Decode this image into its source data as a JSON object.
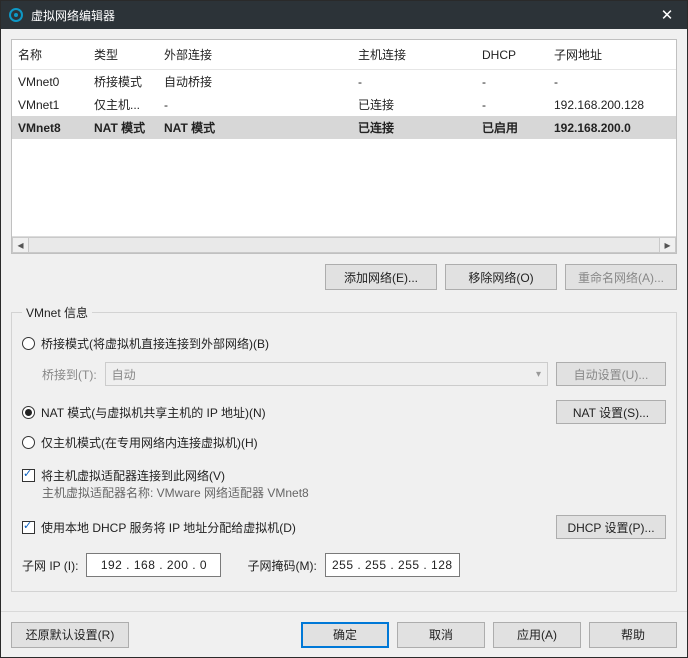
{
  "title": "虚拟网络编辑器",
  "table": {
    "headers": {
      "name": "名称",
      "type": "类型",
      "external": "外部连接",
      "host": "主机连接",
      "dhcp": "DHCP",
      "subnet": "子网地址"
    },
    "rows": [
      {
        "name": "VMnet0",
        "type": "桥接模式",
        "external": "自动桥接",
        "host": "-",
        "dhcp": "-",
        "subnet": "-",
        "selected": false
      },
      {
        "name": "VMnet1",
        "type": "仅主机...",
        "external": "-",
        "host": "已连接",
        "dhcp": "-",
        "subnet": "192.168.200.128",
        "selected": false
      },
      {
        "name": "VMnet8",
        "type": "NAT 模式",
        "external": "NAT 模式",
        "host": "已连接",
        "dhcp": "已启用",
        "subnet": "192.168.200.0",
        "selected": true
      }
    ]
  },
  "buttons": {
    "add_network": "添加网络(E)...",
    "remove_network": "移除网络(O)",
    "rename_network": "重命名网络(A)..."
  },
  "info": {
    "legend": "VMnet 信息",
    "bridged_label": "桥接模式(将虚拟机直接连接到外部网络)(B)",
    "bridge_to_label": "桥接到(T):",
    "bridge_to_value": "自动",
    "auto_settings": "自动设置(U)...",
    "nat_label": "NAT 模式(与虚拟机共享主机的 IP 地址)(N)",
    "nat_settings": "NAT 设置(S)...",
    "hostonly_label": "仅主机模式(在专用网络内连接虚拟机)(H)",
    "connect_adapter_label": "将主机虚拟适配器连接到此网络(V)",
    "adapter_name_line": "主机虚拟适配器名称: VMware 网络适配器 VMnet8",
    "use_dhcp_label": "使用本地 DHCP 服务将 IP 地址分配给虚拟机(D)",
    "dhcp_settings": "DHCP 设置(P)...",
    "subnet_ip_label": "子网 IP (I):",
    "subnet_ip_value": "192 . 168 . 200 .   0",
    "subnet_mask_label": "子网掩码(M):",
    "subnet_mask_value": "255 . 255 . 255 . 128"
  },
  "footer": {
    "restore": "还原默认设置(R)",
    "ok": "确定",
    "cancel": "取消",
    "apply": "应用(A)",
    "help": "帮助"
  }
}
